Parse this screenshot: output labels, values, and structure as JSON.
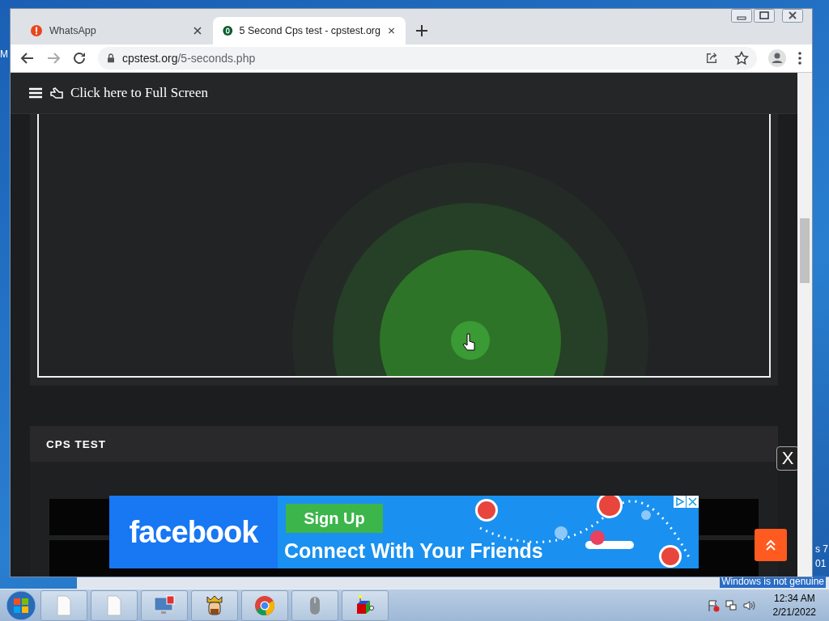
{
  "desktop": {
    "left_text": "M",
    "right_texts": [
      "s 7",
      "01"
    ],
    "notice": "Windows is not genuine"
  },
  "browser": {
    "tabs": [
      {
        "title": "WhatsApp",
        "kind": "alert",
        "selected": false
      },
      {
        "title": "5 Second Cps test - cpstest.org",
        "kind": "site",
        "selected": true
      }
    ],
    "address": {
      "host": "cpstest.org",
      "path": "/5-seconds.php"
    }
  },
  "page": {
    "header": "Click here to Full Screen",
    "card_title": "CPS TEST",
    "close_label": "X"
  },
  "ad": {
    "brand": "facebook",
    "button": "Sign Up",
    "headline": "Connect With Your Friends"
  },
  "taskbar": {
    "buttons": [
      {
        "kind": "document"
      },
      {
        "kind": "document"
      },
      {
        "kind": "monitor"
      },
      {
        "kind": "king"
      },
      {
        "kind": "chrome"
      },
      {
        "kind": "mouse"
      },
      {
        "kind": "cube"
      }
    ],
    "time": "12:34 AM",
    "date": "2/21/2022"
  }
}
